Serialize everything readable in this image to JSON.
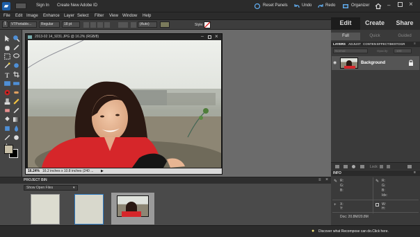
{
  "topbar": {
    "sign_in": "Sign In",
    "create_id": "Create New Adobe ID",
    "reset_panels": "Reset Panels",
    "undo": "Undo",
    "redo": "Redo",
    "organizer": "Organizer"
  },
  "menu": [
    "File",
    "Edit",
    "Image",
    "Enhance",
    "Layer",
    "Select",
    "Filter",
    "View",
    "Window",
    "Help"
  ],
  "options": {
    "font_family": "VTPortable...",
    "font_style": "Regular",
    "font_size": "18 pt",
    "leading": "(Auto)",
    "style_label": "Style:"
  },
  "modes": {
    "edit": "Edit",
    "create": "Create",
    "share": "Share"
  },
  "subtabs": {
    "full": "Full",
    "quick": "Quick",
    "guided": "Guided"
  },
  "layers_tabs": [
    "LAYERS",
    "ADJUST",
    "CONTEN",
    "EFFECTS",
    "HISTOGR"
  ],
  "layers_opts": {
    "blend": "Normal",
    "opacity": "Opacity:",
    "opacity_value": "100"
  },
  "layer": {
    "name": "Background"
  },
  "layers_footer": {
    "lock": "Lock:"
  },
  "document": {
    "title": "2013-02 14_9231.JPG @ 16.2% (RGB/8)",
    "zoom": "16.24%",
    "size": "16.2 inches x 10.8 inches (240 ..."
  },
  "project_bin": {
    "title": "PROJECT BIN",
    "show": "Show Open Files"
  },
  "info": {
    "title": "INFO",
    "r": "R:",
    "g": "G:",
    "b": "B:",
    "idx": "Idx:",
    "x": "X:",
    "y": "Y:",
    "w": "W:",
    "h": "H:",
    "doc": "Doc: 20.8M/20.8M"
  },
  "status": {
    "tip": "Discover what Recompose can do.Click here."
  },
  "colors": {
    "accent": "#2e7bc4",
    "foreground": "#c8c0a8",
    "background": "#000000"
  }
}
